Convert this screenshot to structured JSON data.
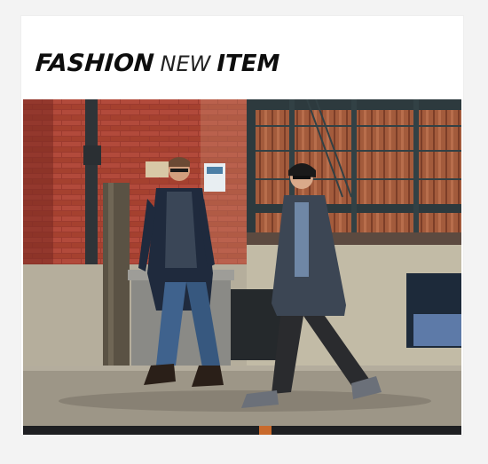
{
  "banner": {
    "title_word1": "FASHION",
    "title_word2": "NEW",
    "title_word3": "ITEM"
  },
  "photo": {
    "description_icon": "street-photo-image"
  }
}
